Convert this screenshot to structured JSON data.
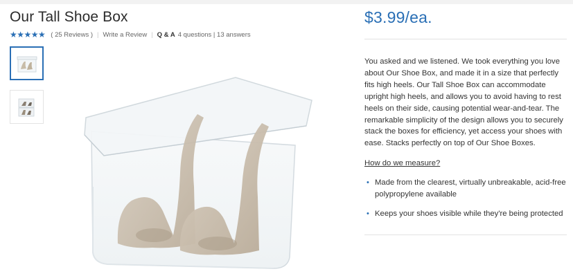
{
  "product": {
    "title": "Our Tall Shoe Box",
    "rating_stars": "★★★★★",
    "reviews": "( 25 Reviews )",
    "write_review": "Write a Review",
    "qa_label": "Q & A",
    "qa_stats": "4 questions | 13 answers",
    "price": "$3.99/ea.",
    "description": "You asked and we listened. We took everything you love about Our Shoe Box, and made it in a size that perfectly fits high heels. Our Tall Shoe Box can accommodate upright high heels, and allows you to avoid having to rest heels on their side, causing potential wear-and-tear. The remarkable simplicity of the design allows you to securely stack the boxes for efficiency, yet access your shoes with ease. Stacks perfectly on top of Our Shoe Boxes.",
    "measure_link": "How do we measure?",
    "features": [
      "Made from the clearest, virtually unbreakable, acid-free polypropylene available",
      "Keeps your shoes visible while they're being protected"
    ]
  },
  "colors": {
    "accent": "#2a6fb5",
    "text": "#333333"
  },
  "icons": {
    "rating": "star-icon",
    "bullet": "bullet-icon"
  }
}
